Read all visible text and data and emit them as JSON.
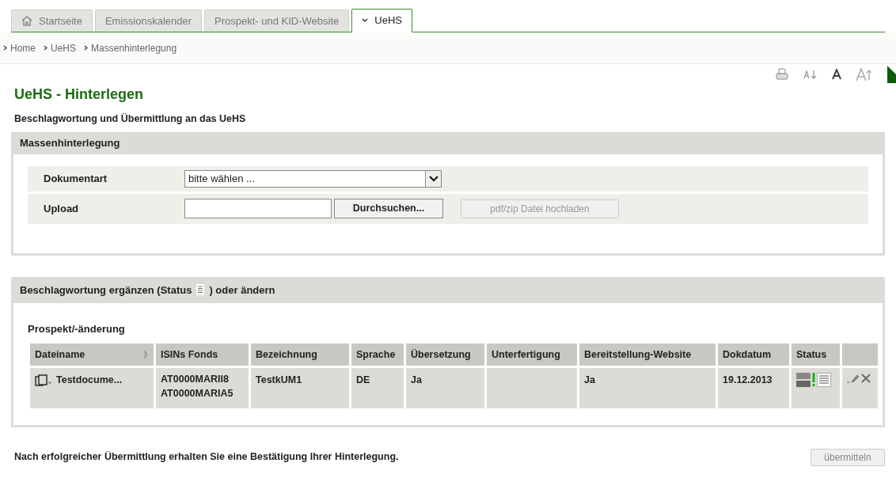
{
  "tabs": [
    {
      "label": "Startseite",
      "kind": "home",
      "selected": false
    },
    {
      "label": "Emissionskalender",
      "selected": false
    },
    {
      "label": "Prospekt- und KID-Website",
      "selected": false
    },
    {
      "label": "UeHS",
      "kind": "menu",
      "selected": true
    }
  ],
  "breadcrumb": [
    "Home",
    "UeHS",
    "Massenhinterlegung"
  ],
  "page": {
    "title": "UeHS - Hinterlegen",
    "subtitle": "Beschlagwortung und Übermittlung an das UeHS"
  },
  "upload_panel": {
    "title": "Massenhinterlegung",
    "document_type": {
      "label": "Dokumentart",
      "value": "bitte wählen ..."
    },
    "upload": {
      "label": "Upload",
      "browse_button": "Durchsuchen...",
      "upload_button": {
        "label": "pdf/zip Datei hochladen",
        "disabled": true
      }
    }
  },
  "edit_panel": {
    "title_before": "Beschlagwortung ergänzen (Status",
    "title_after": ") oder ändern",
    "section": "Prospekt/-änderung",
    "table": {
      "columns": [
        "Dateiname",
        "ISINs Fonds",
        "Bezeichnung",
        "Sprache",
        "Übersetzung",
        "Unterfertigung",
        "Bereitstellung-Website",
        "Dokdatum",
        "Status"
      ],
      "rows": [
        {
          "file": "Testdocume...",
          "isins": [
            "AT0000MARII8",
            "AT0000MARIA5"
          ],
          "name": "TestkUM1",
          "language": "DE",
          "translation": "Ja",
          "signature": "",
          "website": "Ja",
          "date": "19.12.2013"
        }
      ]
    }
  },
  "footer": {
    "note": "Nach erfolgreicher Übermittlung erhalten Sie eine Bestätigung Ihrer Hinterlegung.",
    "submit_button": {
      "label": "übermitteln",
      "disabled": true
    }
  }
}
